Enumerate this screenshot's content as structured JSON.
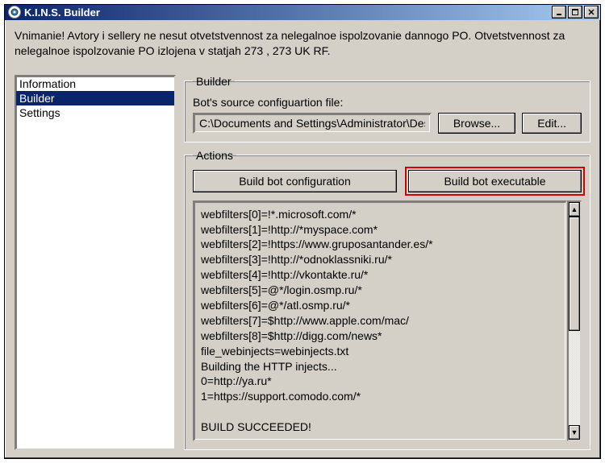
{
  "window": {
    "title": "K.I.N.S. Builder"
  },
  "warning": "Vnimanie! Avtory i sellery ne nesut otvetstvennost za nelegalnoe ispolzovanie dannogo PO. Otvetstvennost za nelegalnoe ispolzovanie PO izlojena v statjah 273 , 273 UK RF.",
  "sidebar": {
    "items": [
      {
        "label": "Information",
        "selected": false
      },
      {
        "label": "Builder",
        "selected": true
      },
      {
        "label": "Settings",
        "selected": false
      }
    ]
  },
  "builder": {
    "legend": "Builder",
    "config_label": "Bot's source configuartion file:",
    "config_path": "C:\\Documents and Settings\\Administrator\\Desktop",
    "browse_label": "Browse...",
    "edit_label": "Edit..."
  },
  "actions": {
    "legend": "Actions",
    "build_config_label": "Build bot configuration",
    "build_exe_label": "Build bot executable",
    "output": "webfilters[0]=!*.microsoft.com/*\nwebfilters[1]=!http://*myspace.com*\nwebfilters[2]=!https://www.gruposantander.es/*\nwebfilters[3]=!http://*odnoklassniki.ru/*\nwebfilters[4]=!http://vkontakte.ru/*\nwebfilters[5]=@*/login.osmp.ru/*\nwebfilters[6]=@*/atl.osmp.ru/*\nwebfilters[7]=$http://www.apple.com/mac/\nwebfilters[8]=$http://digg.com/news*\nfile_webinjects=webinjects.txt\nBuilding the HTTP injects...\n0=http://ya.ru*\n1=https://support.comodo.com/*\n\nBUILD SUCCEEDED!"
  }
}
